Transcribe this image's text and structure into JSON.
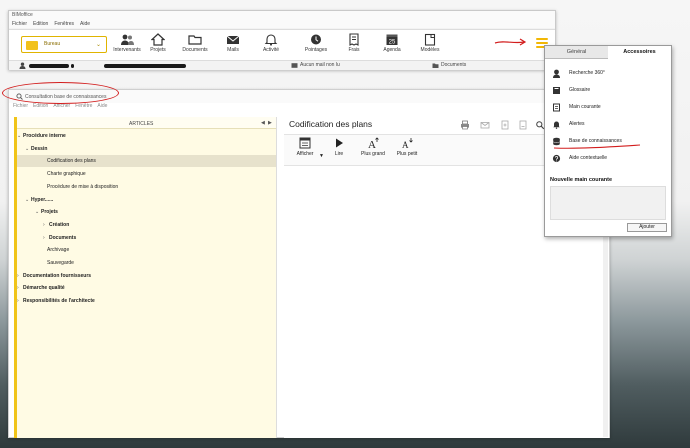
{
  "main_window": {
    "title": "BIMoffice",
    "menu": [
      "Fichier",
      "Edition",
      "Fenêtres",
      "Aide"
    ],
    "app_selector": {
      "label": "Bureau"
    },
    "toolbar": [
      {
        "label": "Intervenants",
        "icon": "people-icon"
      },
      {
        "label": "Projets",
        "icon": "house-icon"
      },
      {
        "label": "Documents",
        "icon": "folder-icon"
      },
      {
        "label": "Mails",
        "icon": "envelope-icon"
      },
      {
        "label": "Activité",
        "icon": "bell-icon"
      },
      {
        "label": "Pointages",
        "icon": "clock-icon"
      },
      {
        "label": "Frais",
        "icon": "receipt-icon"
      },
      {
        "label": "Agenda",
        "icon": "calendar-icon"
      },
      {
        "label": "Modèles",
        "icon": "template-icon"
      }
    ],
    "calendar_day": "25",
    "status": {
      "mail": "Aucun mail non lu",
      "documents": "Documents"
    }
  },
  "panel": {
    "tabs": [
      "Général",
      "Accessoires"
    ],
    "active_tab": "Accessoires",
    "items": [
      {
        "label": "Recherche 360°",
        "icon": "search-360-icon"
      },
      {
        "label": "Glossaire",
        "icon": "book-icon"
      },
      {
        "label": "Main courante",
        "icon": "notebook-icon"
      },
      {
        "label": "Alertes",
        "icon": "alert-icon"
      },
      {
        "label": "Base de connaissances",
        "icon": "database-icon"
      },
      {
        "label": "Aide contextuelle",
        "icon": "help-icon"
      }
    ],
    "new_entry_title": "Nouvelle main courante",
    "add_button": "Ajouter"
  },
  "kb_window": {
    "title": "Consultation base de connaissances",
    "menu": [
      "Fichier",
      "Edition",
      "Afficher",
      "Fenêtre",
      "Aide"
    ],
    "articles_header": "ARTICLES",
    "tree": [
      {
        "label": "Procédure interne",
        "level": 0,
        "bold": true,
        "expanded": true
      },
      {
        "label": "Dessin",
        "level": 1,
        "bold": true,
        "expanded": true
      },
      {
        "label": "Codification des plans",
        "level": 2,
        "bold": false,
        "selected": true
      },
      {
        "label": "Charte graphique",
        "level": 2,
        "bold": false
      },
      {
        "label": "Procédure de mise à disposition",
        "level": 2,
        "bold": false
      },
      {
        "label": "Hyper......",
        "level": 1,
        "bold": true,
        "expanded": true
      },
      {
        "label": "Projets",
        "level": 2,
        "bold": true,
        "expanded": true
      },
      {
        "label": "Création",
        "level": 3,
        "bold": true,
        "expanded": false
      },
      {
        "label": "Documents",
        "level": 3,
        "bold": true,
        "expanded": false
      },
      {
        "label": "Archivage",
        "level": 2,
        "bold": false
      },
      {
        "label": "Sauvegarde",
        "level": 2,
        "bold": false
      },
      {
        "label": "Documentation fournisseurs",
        "level": 0,
        "bold": true,
        "expanded": false
      },
      {
        "label": "Démarche qualité",
        "level": 0,
        "bold": true,
        "expanded": false
      },
      {
        "label": "Responsibilités de l'architecte",
        "level": 0,
        "bold": true,
        "expanded": false
      }
    ],
    "article_title": "Codification des plans",
    "article_tools": [
      {
        "label": "Afficher",
        "icon": "display-icon"
      },
      {
        "label": "Lire",
        "icon": "play-icon"
      },
      {
        "label": "Plus grand",
        "icon": "font-larger-icon"
      },
      {
        "label": "Plus petit",
        "icon": "font-smaller-icon"
      }
    ]
  },
  "colors": {
    "accent_yellow": "#f2c21b",
    "annotation_red": "#d21d1d",
    "tree_background": "#fffbe4"
  }
}
